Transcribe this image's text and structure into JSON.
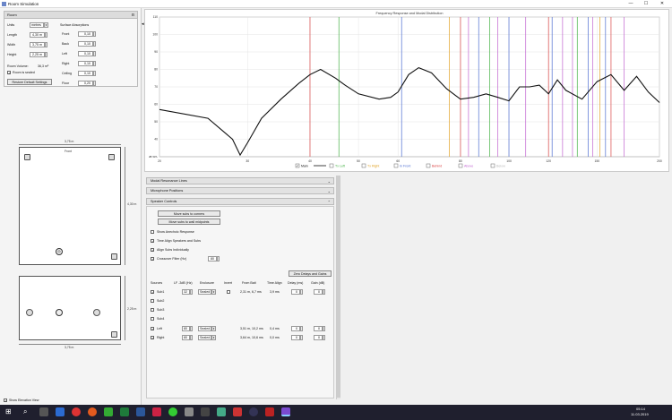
{
  "window": {
    "title": "Room Simulation",
    "minimize": "—",
    "maximize": "☐",
    "close": "✕"
  },
  "room_panel": {
    "title": "Room",
    "collapse": "⊟",
    "units_label": "Units",
    "units_value": "metres",
    "length_label": "Length",
    "length_value": "4,30 m",
    "width_label": "Width",
    "width_value": "3,75 m",
    "height_label": "Height",
    "height_value": "2,25 m",
    "volume_label": "Room Volume:",
    "volume_value": "36,3 m³",
    "sealed_label": "Room is sealed",
    "restore_button": "Restore Default Settings",
    "surface_title": "Surface Absorptions",
    "surfaces": [
      {
        "label": "Front",
        "value": "0,10"
      },
      {
        "label": "Back",
        "value": "0,10"
      },
      {
        "label": "Left",
        "value": "0,10"
      },
      {
        "label": "Right",
        "value": "0,10"
      },
      {
        "label": "Ceiling",
        "value": "0,10"
      },
      {
        "label": "Floor",
        "value": "0,20"
      }
    ]
  },
  "plan_view": {
    "width_dim": "3,75 m",
    "length_dim": "4,30 m",
    "front_label": "Front"
  },
  "elevation_view": {
    "height_dim": "2,25 m",
    "width_dim": "3,75 m"
  },
  "elevation_toggle": "Show Elevation View",
  "chart_data": {
    "type": "line",
    "title": "Frequency Response and Modal Distribution",
    "x_scale": "log",
    "xlim": [
      20,
      200
    ],
    "ylim": [
      30,
      110
    ],
    "x_ticks": [
      "20",
      "30",
      "40",
      "50",
      "60",
      "80",
      "100",
      "120",
      "150",
      "200"
    ],
    "y_ticks": [
      "110",
      "100",
      "90",
      "80",
      "70",
      "60",
      "50",
      "40",
      "dB SPL"
    ],
    "series": [
      {
        "name": "Main",
        "color": "#111111",
        "x": [
          20,
          25,
          28,
          29,
          30,
          32,
          35,
          38,
          40,
          42,
          45,
          47,
          50,
          55,
          58,
          60,
          63,
          66,
          70,
          75,
          80,
          85,
          90,
          95,
          100,
          105,
          110,
          115,
          120,
          125,
          130,
          140,
          150,
          160,
          170,
          180,
          190,
          200
        ],
        "y": [
          57,
          52,
          40,
          31,
          38,
          52,
          63,
          72,
          77,
          80,
          75,
          71,
          66,
          63,
          64,
          67,
          77,
          81,
          78,
          69,
          63,
          64,
          66,
          64,
          62,
          70,
          70,
          71,
          66,
          74,
          68,
          63,
          73,
          77,
          68,
          76,
          67,
          61
        ]
      }
    ],
    "modal_lines": [
      {
        "type": "axial",
        "color": "#d94040",
        "x": [
          40,
          80,
          120,
          160
        ]
      },
      {
        "type": "axial-left",
        "color": "#40b040",
        "x": [
          45.7,
          91.5,
          137
        ]
      },
      {
        "type": "axial-right",
        "color": "#e0a020",
        "x": [
          76,
          152
        ]
      },
      {
        "type": "tangential",
        "color": "#4a6ad0",
        "x": [
          61,
          87,
          100,
          122,
          144,
          156
        ]
      },
      {
        "type": "oblique",
        "color": "#c060d0",
        "x": [
          83,
          95,
          108,
          128,
          134,
          147,
          170
        ]
      }
    ],
    "legend": [
      {
        "label": "Main",
        "checked": true,
        "color": "#111111"
      },
      {
        "label": "Tx Left",
        "checked": false,
        "color": "#40b040"
      },
      {
        "label": "Tx Right",
        "checked": false,
        "color": "#e0a020"
      },
      {
        "label": "In Front",
        "checked": false,
        "color": "#4a6ad0"
      },
      {
        "label": "Behind",
        "checked": false,
        "color": "#d94040"
      },
      {
        "label": "Above",
        "checked": false,
        "color": "#c060d0"
      },
      {
        "label": "Below",
        "checked": false,
        "color": "#bbbbbb"
      }
    ]
  },
  "sections": {
    "modal": "Modal Resonance Lines",
    "mic": "Microphone Positions",
    "speaker": "Speaker Controls"
  },
  "speaker_controls": {
    "move_corners": "Move subs to corners",
    "move_midpoints": "Move subs to wall midpoints",
    "show_anechoic": "Show Anechoic Response",
    "time_align": "Time Align Speakers and Subs",
    "align_individually": "Align Subs Individually",
    "crossover_label": "Crossover Filter (Hz)",
    "crossover_value": "80",
    "zero_button": "Zero Delays and Gains",
    "headers": [
      "Sources",
      "LF -3dB (Hz)",
      "Enclosure",
      "Invert",
      "From Bait",
      "Time Align",
      "Delay (ms)",
      "Gain (dB)"
    ],
    "rows": [
      {
        "name": "Sub1",
        "checked": true,
        "lf": "32",
        "enclosure": "Sealed",
        "from": "2,31 m, 6,7 ms",
        "align": "3,9 ms",
        "delay": "0",
        "gain": "0"
      },
      {
        "name": "Sub2",
        "checked": false
      },
      {
        "name": "Sub3",
        "checked": false
      },
      {
        "name": "Sub4",
        "checked": false
      },
      {
        "name": "Left",
        "checked": true,
        "lf": "80",
        "enclosure": "Sealed",
        "from": "3,51 m, 10,2 ms",
        "align": "0,4 ms",
        "delay": "0",
        "gain": "0"
      },
      {
        "name": "Right",
        "checked": true,
        "lf": "80",
        "enclosure": "Sealed",
        "from": "3,64 m, 10,6 ms",
        "align": "0,0 ms",
        "delay": "0",
        "gain": "0"
      }
    ]
  },
  "taskbar": {
    "time": "05:14",
    "date": "11.03.2019",
    "search_icon": "⌕",
    "start_icon": "⊞"
  }
}
